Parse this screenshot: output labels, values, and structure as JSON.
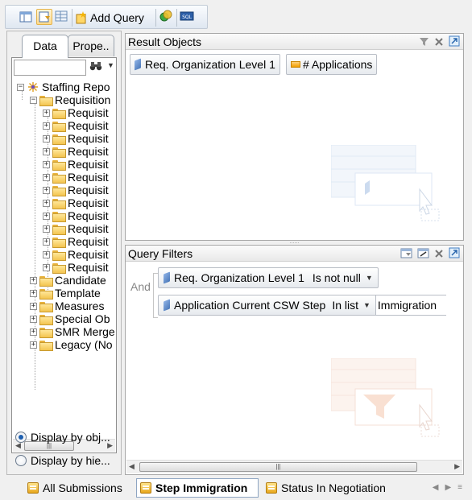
{
  "toolbar": {
    "add_query_label": "Add Query",
    "icons": [
      "result-view-icon",
      "query-view-icon",
      "data-preview-icon",
      "add-query-icon",
      "combine-queries-icon",
      "sql-icon"
    ]
  },
  "left_panel": {
    "tabs": [
      {
        "label": "Data"
      },
      {
        "label": "Prope.."
      }
    ],
    "search": {
      "value": ""
    },
    "tree": {
      "root": "Staffing Repo",
      "open_folder": "Requisition",
      "requisition_children": [
        "Requisit",
        "Requisit",
        "Requisit",
        "Requisit",
        "Requisit",
        "Requisit",
        "Requisit",
        "Requisit",
        "Requisit",
        "Requisit",
        "Requisit",
        "Requisit",
        "Requisit"
      ],
      "other_folders": [
        "Candidate",
        "Template",
        "Measures",
        "Special Ob",
        "SMR Merge",
        "Legacy (No"
      ]
    },
    "radio": {
      "display_by_objects": "Display by obj...",
      "display_by_hierarchy": "Display by hie..."
    }
  },
  "result_objects": {
    "title": "Result Objects",
    "items": [
      {
        "label": "Req. Organization Level 1",
        "kind": "dimension"
      },
      {
        "label": "# Applications",
        "kind": "measure"
      }
    ]
  },
  "query_filters": {
    "title": "Query Filters",
    "operator": "And",
    "filters": [
      {
        "field": "Req. Organization Level 1",
        "op": "Is not null",
        "value": ""
      },
      {
        "field": "Application Current CSW Step",
        "op": "In list",
        "value": "Immigration"
      }
    ]
  },
  "bottom_tabs": [
    {
      "label": "All Submissions",
      "active": false
    },
    {
      "label": "Step Immigration",
      "active": true
    },
    {
      "label": "Status In Negotiation",
      "active": false
    }
  ]
}
